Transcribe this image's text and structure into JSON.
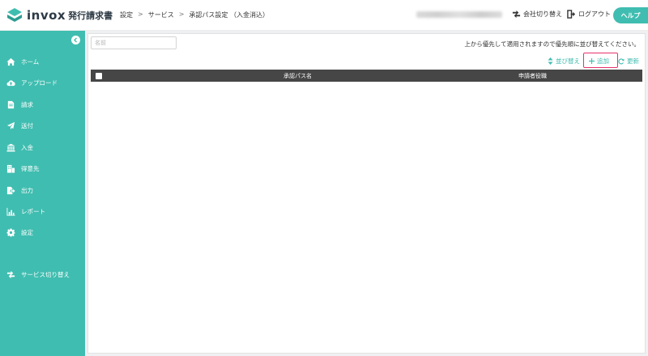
{
  "app": {
    "logo_word": "invox",
    "logo_sub": "発行請求書"
  },
  "breadcrumb": [
    "設定",
    "サービス",
    "承認パス設定 （入金消込）"
  ],
  "breadcrumb_sep": ">",
  "header": {
    "switch_company": "会社切り替え",
    "logout": "ログアウト",
    "help": "ヘルプ"
  },
  "sidebar": {
    "items": [
      {
        "label": "ホーム",
        "icon": "home-icon"
      },
      {
        "label": "アップロード",
        "icon": "cloud-upload-icon"
      },
      {
        "label": "請求",
        "icon": "document-icon"
      },
      {
        "label": "送付",
        "icon": "paper-plane-icon"
      },
      {
        "label": "入金",
        "icon": "bank-icon"
      },
      {
        "label": "得意先",
        "icon": "building-icon"
      },
      {
        "label": "出力",
        "icon": "file-export-icon"
      },
      {
        "label": "レポート",
        "icon": "chart-icon"
      },
      {
        "label": "設定",
        "icon": "gear-icon"
      }
    ],
    "service_switch": "サービス切り替え"
  },
  "main": {
    "search_placeholder": "名前",
    "notice": "上から優先して適用されますので優先順に並び替えてください。",
    "toolbar": {
      "sort": "並び替え",
      "add": "追加",
      "refresh": "更新"
    },
    "table": {
      "columns": [
        "承認パス名",
        "申請者役職"
      ]
    }
  },
  "colors": {
    "accent": "#3fbdb0",
    "table_header": "#464646",
    "highlight": "#e6336b"
  }
}
